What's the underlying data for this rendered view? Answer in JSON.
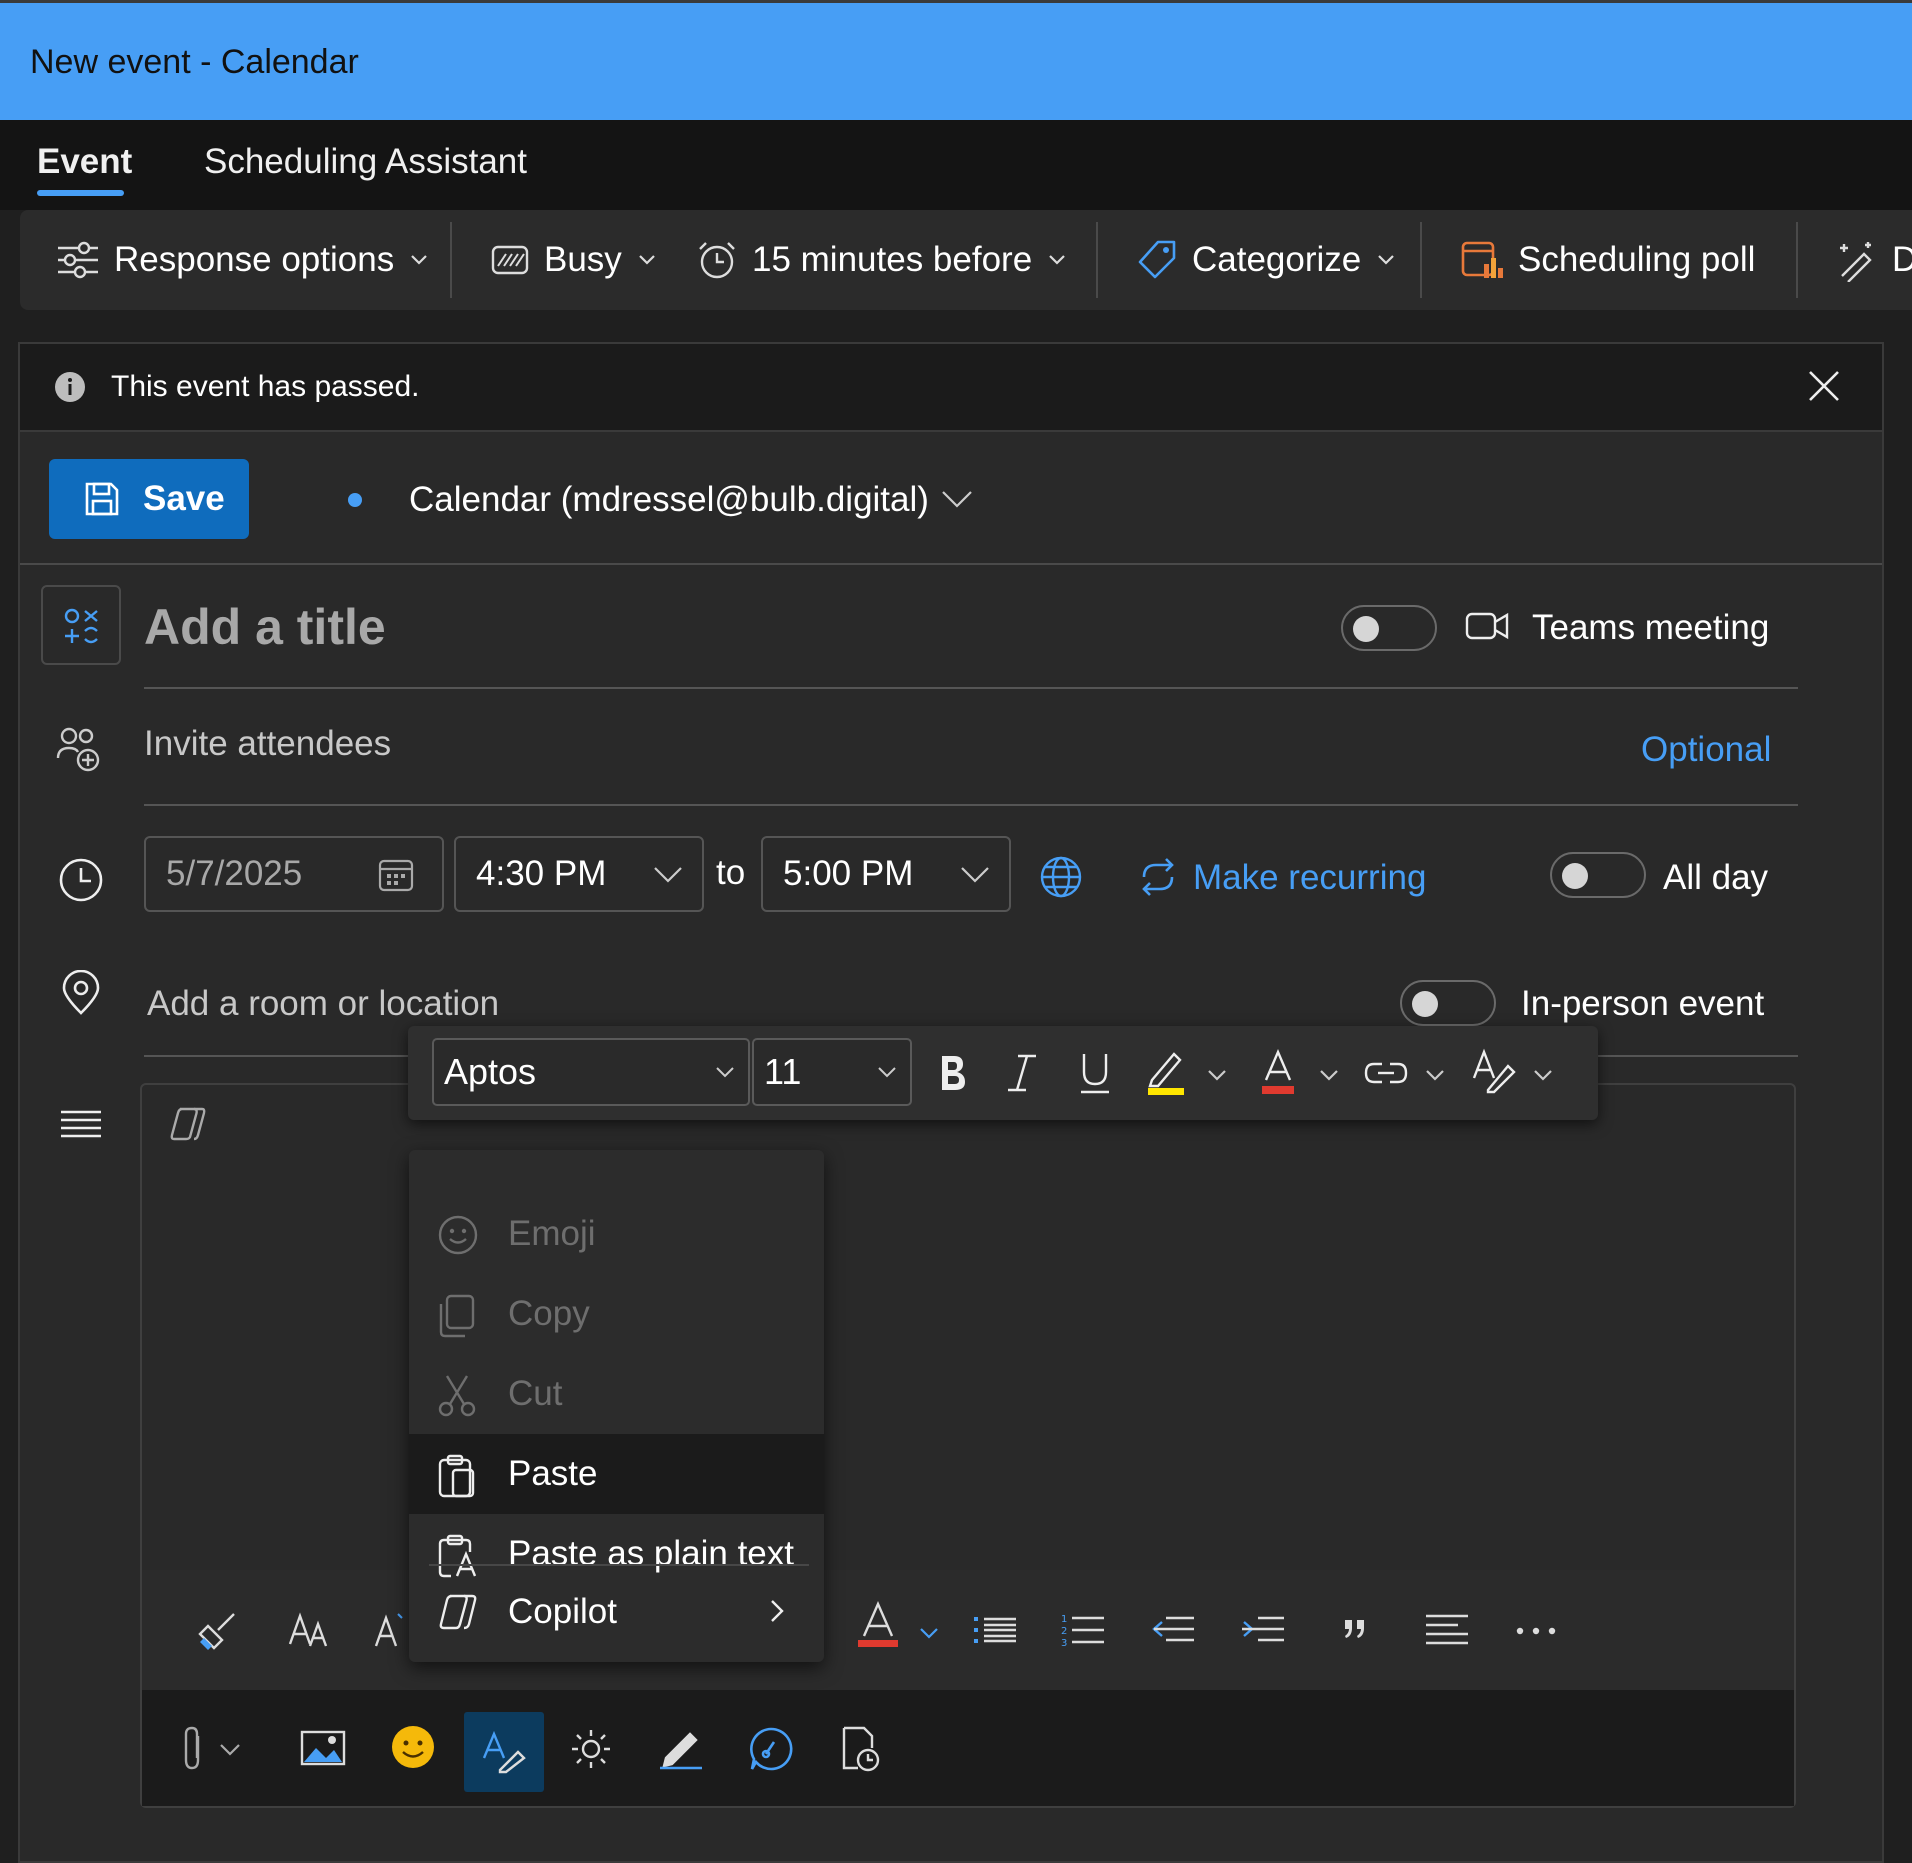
{
  "window": {
    "title": "New event - Calendar"
  },
  "tabs": [
    {
      "label": "Event",
      "active": true
    },
    {
      "label": "Scheduling Assistant",
      "active": false
    }
  ],
  "ribbon": {
    "response_options": "Response options",
    "show_as": "Busy",
    "reminder": "15 minutes before",
    "categorize": "Categorize",
    "scheduling_poll": "Scheduling poll",
    "overflow_letter": "D"
  },
  "banner": {
    "text": "This event has passed."
  },
  "form": {
    "save_label": "Save",
    "calendar": "Calendar (mdressel@bulb.digital)",
    "title_placeholder": "Add a title",
    "teams_meeting": "Teams meeting",
    "attendees_placeholder": "Invite attendees",
    "optional_link": "Optional",
    "date": "5/7/2025",
    "start_time": "4:30 PM",
    "to_label": "to",
    "end_time": "5:00 PM",
    "make_recurring": "Make recurring",
    "all_day": "All day",
    "location_placeholder": "Add a room or location",
    "in_person": "In-person event"
  },
  "format_toolbar": {
    "font": "Aptos",
    "size": "11"
  },
  "context_menu": {
    "items": [
      {
        "label": "Emoji",
        "icon": "emoji-icon",
        "disabled": true
      },
      {
        "label": "Copy",
        "icon": "copy-icon",
        "disabled": true
      },
      {
        "label": "Cut",
        "icon": "cut-icon",
        "disabled": true
      },
      {
        "label": "Paste",
        "icon": "paste-icon",
        "disabled": false
      },
      {
        "label": "Paste as plain text",
        "icon": "paste-plain-icon",
        "disabled": false
      },
      {
        "label": "Copilot",
        "icon": "copilot-icon",
        "disabled": false
      }
    ]
  },
  "colors": {
    "accent": "#479ef5",
    "save_button": "#0f6cbd",
    "highlight_yellow": "#ffe600",
    "font_color_red": "#e03a2f"
  }
}
